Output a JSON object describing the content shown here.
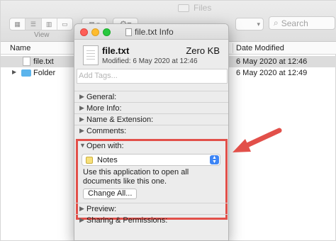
{
  "finder": {
    "window_title": "Files",
    "view_label": "View",
    "search_placeholder": "Search",
    "columns": {
      "name": "Name",
      "date_modified": "Date Modified"
    },
    "rows": [
      {
        "name": "file.txt",
        "date": "6 May 2020 at 12:46",
        "selected": true
      },
      {
        "name": "Folder",
        "date": "6 May 2020 at 12:49",
        "selected": false
      }
    ]
  },
  "info": {
    "window_title": "file.txt Info",
    "file_name": "file.txt",
    "file_size": "Zero KB",
    "modified": "Modified: 6 May 2020 at 12:46",
    "tags_placeholder": "Add Tags...",
    "sections_top": [
      "General:",
      "More Info:",
      "Name & Extension:",
      "Comments:"
    ],
    "open_with": {
      "label": "Open with:",
      "app": "Notes",
      "description": "Use this application to open all documents like this one.",
      "change_all": "Change All..."
    },
    "sections_bottom": [
      "Preview:",
      "Sharing & Permissions:"
    ]
  },
  "colors": {
    "highlight": "#e2504a",
    "accent": "#3d85f5",
    "folder": "#5bb4ec"
  }
}
